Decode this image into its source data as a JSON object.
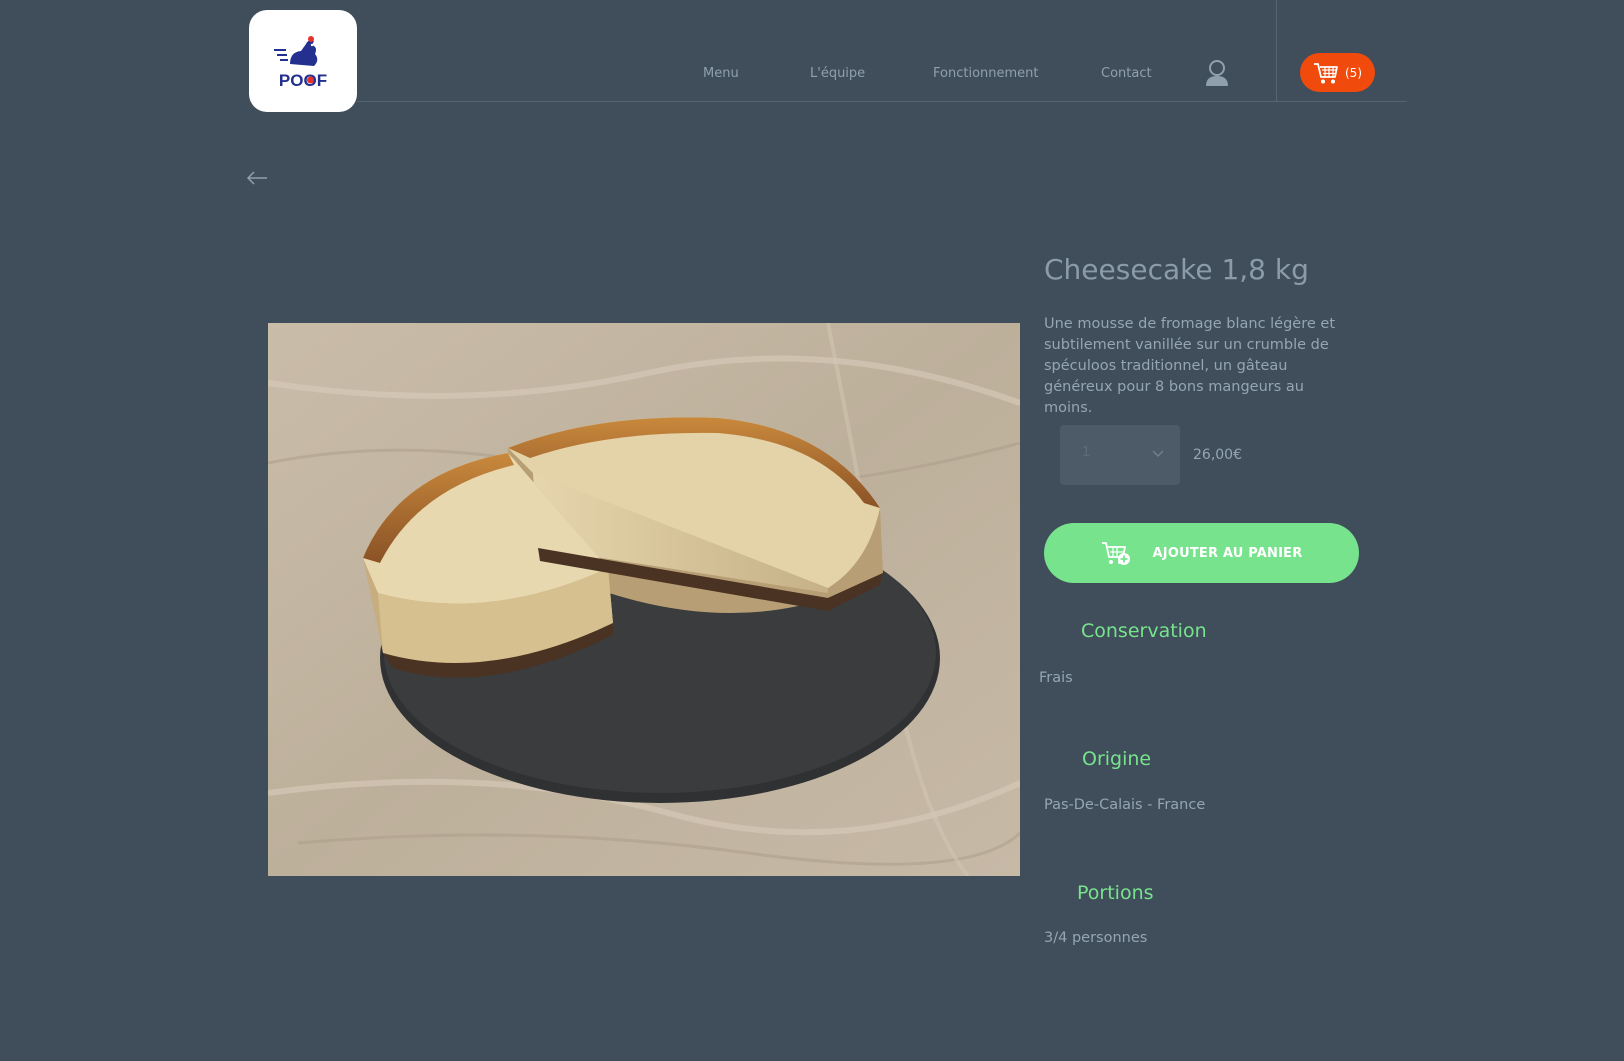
{
  "header": {
    "logo_text": "POOF",
    "nav": [
      {
        "label": "Menu"
      },
      {
        "label": "L'équipe"
      },
      {
        "label": "Fonctionnement"
      },
      {
        "label": "Contact"
      }
    ],
    "cart_count": "(5)"
  },
  "product": {
    "title": "Cheesecake 1,8 kg",
    "description": "Une mousse de fromage blanc légère et subtilement vanillée sur un crumble de spéculoos traditionnel, un gâteau généreux pour 8 bons mangeurs au moins.",
    "quantity": "1",
    "price": "26,00€",
    "add_label": "AJOUTER AU PANIER"
  },
  "details": {
    "conservation": {
      "title": "Conservation",
      "value": "Frais"
    },
    "origine": {
      "title": "Origine",
      "value": "Pas-De-Calais - France"
    },
    "portions": {
      "title": "Portions",
      "value": "3/4 personnes"
    }
  },
  "colors": {
    "background": "#3f4e5a",
    "accent_green": "#77e38c",
    "cart_orange": "#f04a0c"
  }
}
